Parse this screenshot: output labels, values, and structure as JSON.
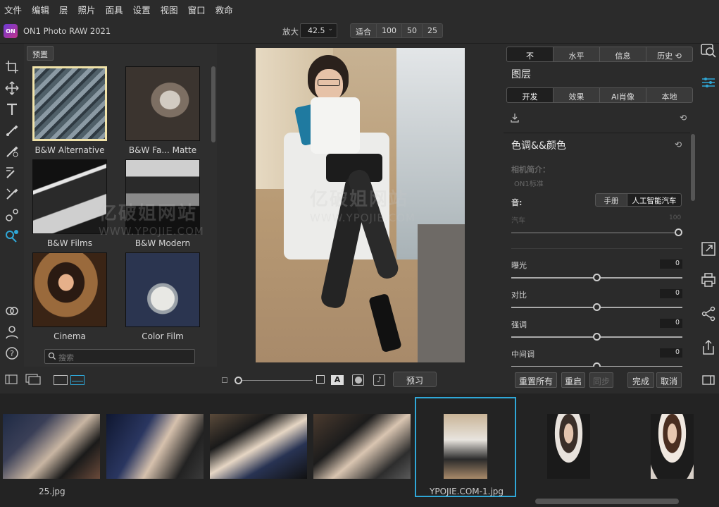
{
  "menu": [
    "文件",
    "编辑",
    "层",
    "照片",
    "面具",
    "设置",
    "视图",
    "窗口",
    "救命"
  ],
  "app": {
    "logo_text": "ON",
    "title": "ON1 Photo RAW 2021"
  },
  "zoom": {
    "label": "放大",
    "value": "42.5",
    "presets": [
      "适合",
      "100",
      "50",
      "25"
    ]
  },
  "presets_panel": {
    "header_button": "预置",
    "items": [
      {
        "label": "B&W Alternative"
      },
      {
        "label": "B&W Fa... Matte"
      },
      {
        "label": "B&W Films"
      },
      {
        "label": "B&W Modern"
      },
      {
        "label": "Cinema"
      },
      {
        "label": "Color Film"
      }
    ],
    "search_placeholder": "搜索"
  },
  "watermark": {
    "cn": "亿破姐网站",
    "en": "WWW.YPOJIE.COM"
  },
  "right_panel": {
    "top_tabs": [
      "不",
      "水平",
      "信息",
      "历史"
    ],
    "layers_title": "图层",
    "sub_tabs": [
      "开发",
      "效果",
      "AI肖像",
      "本地"
    ],
    "section_title": "色调&&颜色",
    "camera_profile_label": "相机简介：",
    "camera_profile_value": "ON1标准",
    "tone_label": "音:",
    "tone_modes": [
      "手册",
      "人工智能汽车"
    ],
    "auto_label": "汽车",
    "auto_value": "100",
    "auto_level": 1.0,
    "adjustments": [
      {
        "label": "曝光",
        "value": "0",
        "level": 0.5
      },
      {
        "label": "对比",
        "value": "0",
        "level": 0.5
      },
      {
        "label": "强调",
        "value": "0",
        "level": 0.5
      },
      {
        "label": "中间调",
        "value": "0",
        "level": 0.5
      }
    ]
  },
  "bottom_buttons": {
    "preview": "预习",
    "reset_all": "重置所有",
    "reset": "重启",
    "sync": "同步",
    "done": "完成",
    "cancel": "取消"
  },
  "filmstrip": {
    "items": [
      "25.jpg",
      "",
      "",
      "",
      "YPOJIE.COM-1.jpg",
      "",
      ""
    ],
    "selected_index": 4
  },
  "colors": {
    "accent": "#2fa7d7",
    "selected_preset": "#f1e3a9"
  }
}
